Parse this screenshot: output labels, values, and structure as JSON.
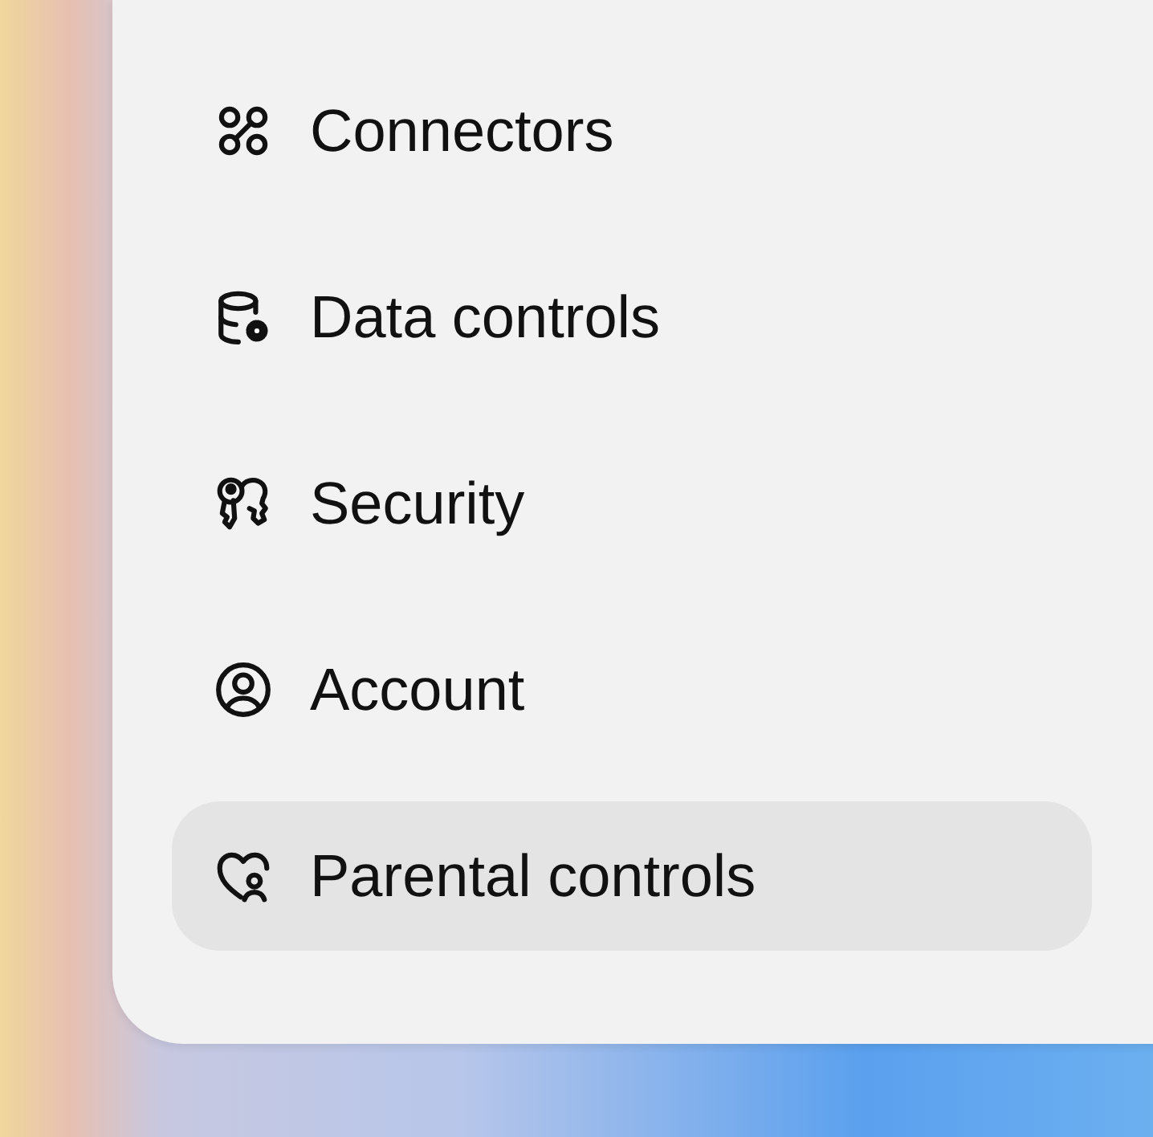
{
  "menu": {
    "items": [
      {
        "kind": "connectors",
        "label": "Connectors",
        "selected": false
      },
      {
        "kind": "data",
        "label": "Data controls",
        "selected": false
      },
      {
        "kind": "security",
        "label": "Security",
        "selected": false
      },
      {
        "kind": "account",
        "label": "Account",
        "selected": false
      },
      {
        "kind": "parental",
        "label": "Parental controls",
        "selected": true
      }
    ]
  }
}
